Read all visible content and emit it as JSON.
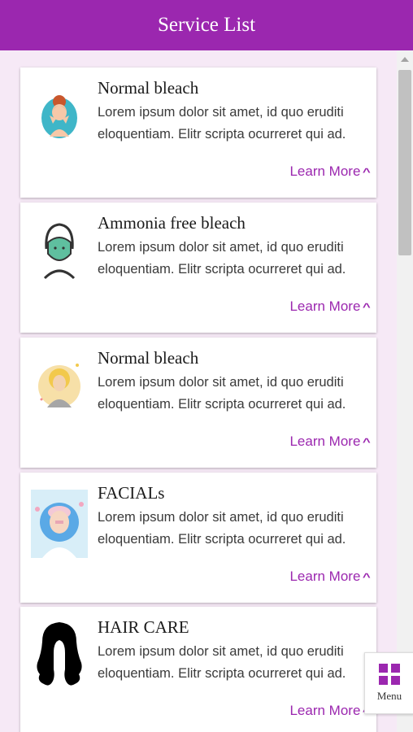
{
  "header": {
    "title": "Service List"
  },
  "services": [
    {
      "title": "Normal bleach",
      "description": "Lorem ipsum dolor sit amet, id quo eruditi eloquentiam. Elitr scripta ocurreret qui ad.",
      "link": "Learn More",
      "icon": "woman-facial-icon"
    },
    {
      "title": "Ammonia free bleach",
      "description": "Lorem ipsum dolor sit amet, id quo eruditi eloquentiam. Elitr scripta ocurreret qui ad.",
      "link": "Learn More",
      "icon": "face-mask-icon"
    },
    {
      "title": "Normal bleach",
      "description": "Lorem ipsum dolor sit amet, id quo eruditi eloquentiam. Elitr scripta ocurreret qui ad.",
      "link": "Learn More",
      "icon": "blonde-woman-icon"
    },
    {
      "title": "FACIALs",
      "description": "Lorem ipsum dolor sit amet, id quo eruditi eloquentiam. Elitr scripta ocurreret qui ad.",
      "link": "Learn More",
      "icon": "spa-facial-icon"
    },
    {
      "title": "HAIR CARE",
      "description": "Lorem ipsum dolor sit amet, id quo eruditi eloquentiam. Elitr scripta ocurreret qui ad.",
      "link": "Learn More",
      "icon": "hair-silhouette-icon"
    }
  ],
  "menu": {
    "label": "Menu",
    "icon": "grid-icon"
  },
  "colors": {
    "accent": "#9b27af",
    "background": "#f6e9f6",
    "card": "#ffffff"
  }
}
